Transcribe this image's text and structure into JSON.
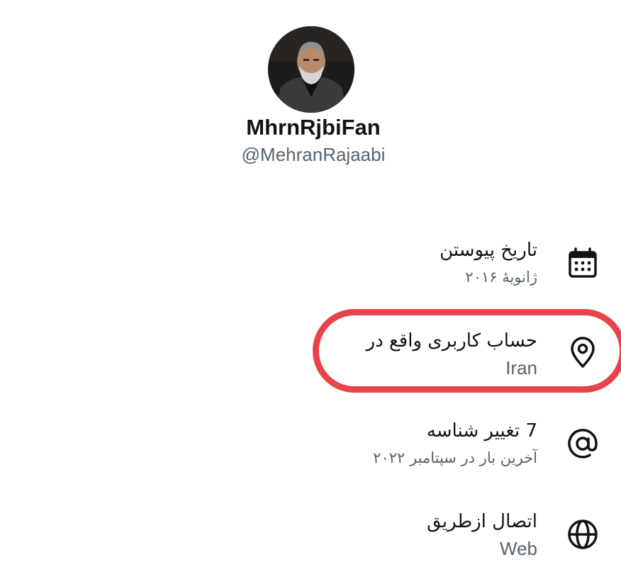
{
  "profile": {
    "display_name": "MhrnRjbiFan",
    "handle": "@MehranRajaabi"
  },
  "about_rows": [
    {
      "icon": "calendar-icon",
      "title": "تاریخ پیوستن",
      "subtitle": "ژانویهٔ ۲۰۱۶"
    },
    {
      "icon": "location-pin-icon",
      "title": "حساب کاربری واقع در",
      "subtitle": "Iran"
    },
    {
      "icon": "at-sign-icon",
      "title": "7 تغییر شناسه",
      "subtitle": "آخرین بار در سپتامبر ۲۰۲۲"
    },
    {
      "icon": "globe-icon",
      "title": "اتصال ازطریق",
      "subtitle": "Web"
    }
  ],
  "colors": {
    "primary_text": "#0f1419",
    "secondary_text": "#536471",
    "highlight_ring": "#e8434a"
  }
}
